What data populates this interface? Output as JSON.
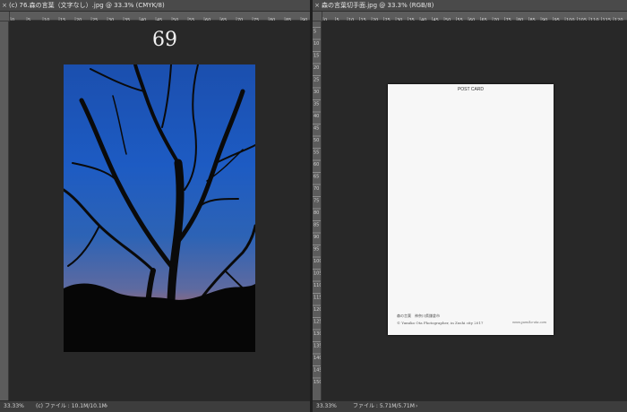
{
  "left_document": {
    "tab_title": "(c) 76.森の言葉（文字なし）.jpg @ 33.3% (CMYK/8)",
    "close_icon": "close-icon",
    "page_number": "69",
    "zoom": "33.33%",
    "file_info": "(c) ファイル : 10.1M/10.1M",
    "status_arrow": "›",
    "top_ruler_labels": [
      "0",
      "5",
      "10",
      "15",
      "20",
      "25",
      "30",
      "35",
      "40",
      "45",
      "50",
      "55",
      "60",
      "65",
      "70",
      "75",
      "80",
      "85",
      "90"
    ]
  },
  "right_document": {
    "tab_title": "森の言葉切手面.jpg @ 33.3% (RGB/8)",
    "close_icon": "close-icon",
    "postcard_title": "POST CARD",
    "postcard_caption": "森の言葉　神奈川県鎌倉市",
    "postcard_credit": "© Yumiko Ota Photographer, in Zushi city 2017",
    "postcard_web": "www.yumiko-ota.com",
    "zoom": "33.33%",
    "file_info": "ファイル : 5.71M/5.71M",
    "status_arrow": "›",
    "top_ruler_labels": [
      "0",
      "5",
      "10",
      "15",
      "20",
      "25",
      "30",
      "35",
      "40",
      "45",
      "50",
      "55",
      "60",
      "65",
      "70",
      "75",
      "80",
      "85",
      "90",
      "95",
      "100",
      "105",
      "110",
      "115",
      "120"
    ],
    "left_ruler_labels": [
      "0",
      "5",
      "10",
      "15",
      "20",
      "25",
      "30",
      "35",
      "40",
      "45",
      "50",
      "55",
      "60",
      "65",
      "70",
      "75",
      "80",
      "85",
      "90",
      "95",
      "100",
      "105",
      "110",
      "115",
      "120",
      "125",
      "130",
      "135",
      "140",
      "145",
      "150"
    ]
  }
}
